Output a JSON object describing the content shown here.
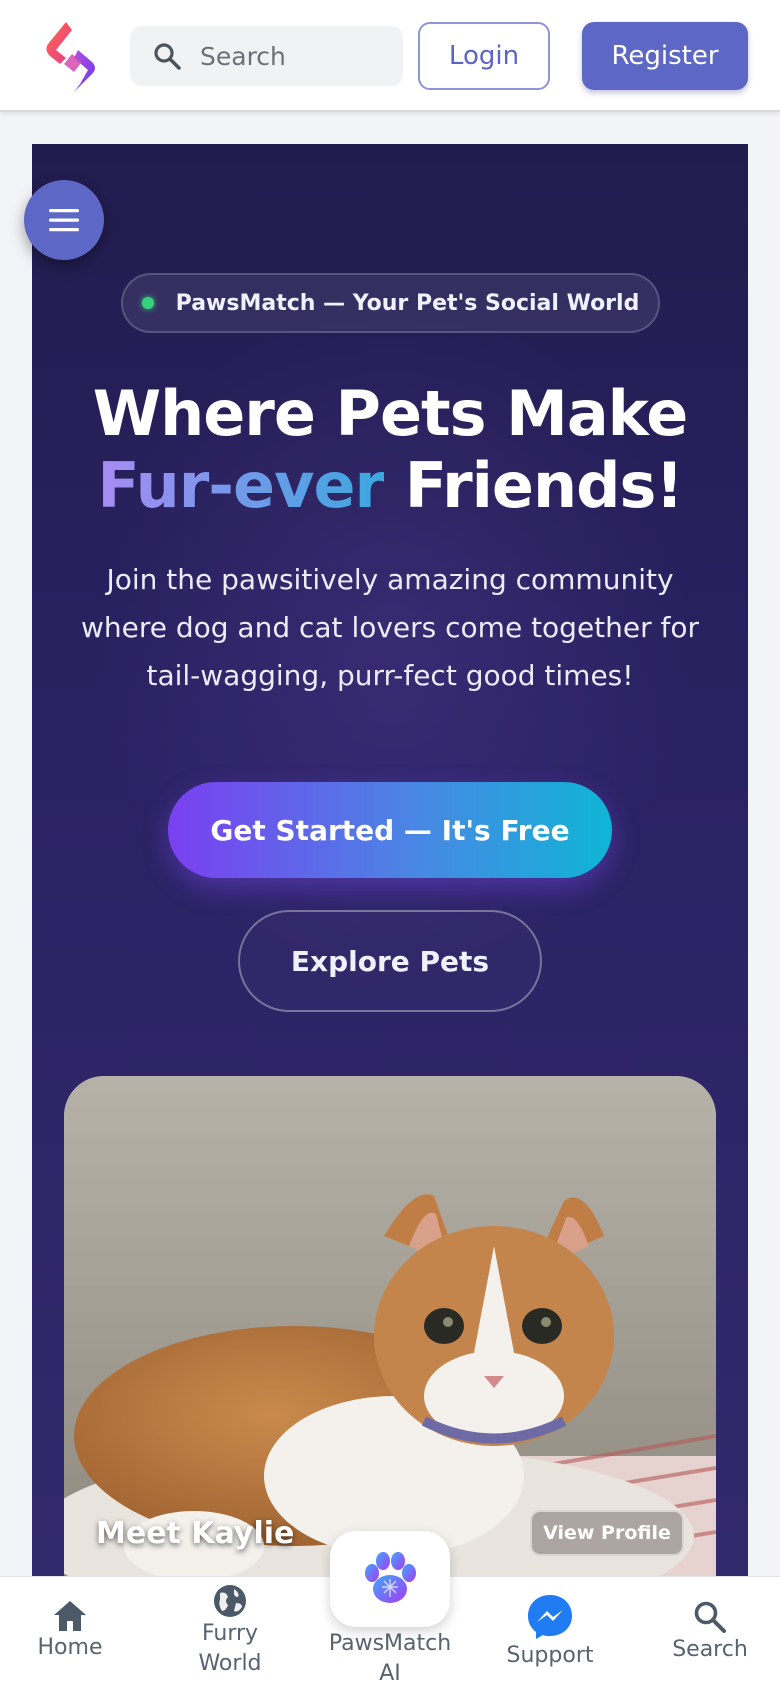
{
  "header": {
    "search_placeholder": "Search",
    "login_label": "Login",
    "register_label": "Register"
  },
  "hero": {
    "badge": "PawsMatch — Your Pet's Social World",
    "headline_line1": "Where Pets Make",
    "headline_highlight": "Fur-ever",
    "headline_rest": "Friends!",
    "subtext": "Join the pawsitively amazing community where dog and cat lovers come together for tail-wagging, purr-fect good times!",
    "cta_primary": "Get Started — It's Free",
    "cta_secondary": "Explore Pets"
  },
  "pet_card": {
    "name": "Meet Kaylie",
    "action": "View Profile"
  },
  "bottom_nav": {
    "items": [
      {
        "label": "Home",
        "icon": "home-icon"
      },
      {
        "label": "Furry World",
        "icon": "globe-icon"
      },
      {
        "label": "PawsMatch AI",
        "icon": "paw-ai-icon"
      },
      {
        "label": "Support",
        "icon": "messenger-icon"
      },
      {
        "label": "Search",
        "icon": "search-icon"
      }
    ]
  },
  "colors": {
    "brand": "#5d67c6",
    "hero_bg": "#2b2264",
    "cta_gradient_start": "#7a3ff0",
    "cta_gradient_end": "#0fb5d6",
    "status_dot": "#34d27a",
    "messenger": "#1f7cf2"
  }
}
